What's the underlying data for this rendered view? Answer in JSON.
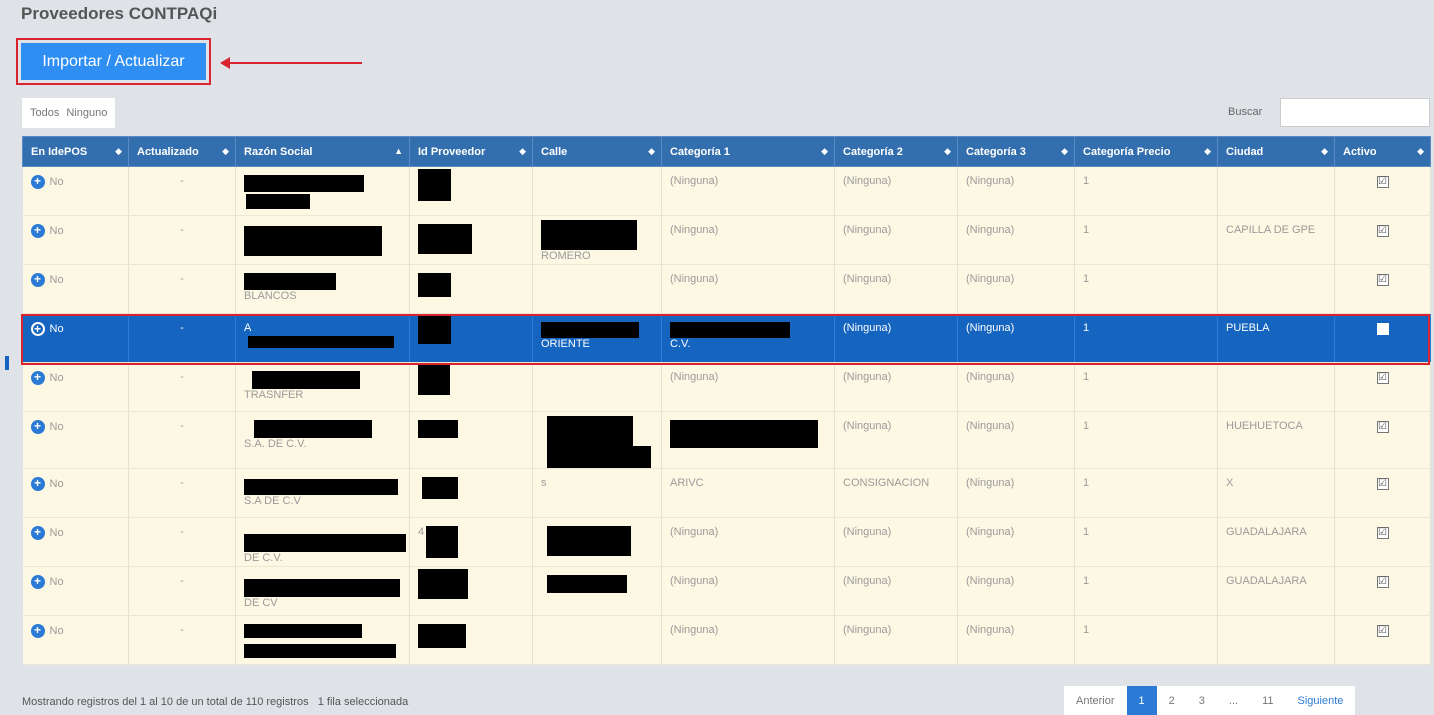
{
  "page": {
    "title": "Proveedores CONTPAQi",
    "import_button": "Importar / Actualizar",
    "select_all": "Todos",
    "select_none": "Ninguno",
    "search_label": "Buscar",
    "search_value": ""
  },
  "table": {
    "headers": [
      "En IdePOS",
      "Actualizado",
      "Razón Social",
      "Id Proveedor",
      "Calle",
      "Categoría 1",
      "Categoría 2",
      "Categoría 3",
      "Categoría Precio",
      "Ciudad",
      "Activo"
    ],
    "rows": [
      {
        "en": "No",
        "act": "-",
        "razon": "",
        "id": "",
        "calle": "",
        "c1": "(Ninguna)",
        "c2": "(Ninguna)",
        "c3": "(Ninguna)",
        "cp": "1",
        "ciudad": "",
        "activo": "☑"
      },
      {
        "en": "No",
        "act": "-",
        "razon": "",
        "id": "",
        "calle": "ROMERO",
        "c1": "(Ninguna)",
        "c2": "(Ninguna)",
        "c3": "(Ninguna)",
        "cp": "1",
        "ciudad": "CAPILLA DE GPE",
        "activo": "☑"
      },
      {
        "en": "No",
        "act": "-",
        "razon": "BLANCOS",
        "id": "",
        "calle": "",
        "c1": "(Ninguna)",
        "c2": "(Ninguna)",
        "c3": "(Ninguna)",
        "cp": "1",
        "ciudad": "",
        "activo": "☑"
      },
      {
        "en": "No",
        "act": "-",
        "razon": "A",
        "id": "",
        "calle": "ORIENTE",
        "c1": "C.V.",
        "c2": "(Ninguna)",
        "c3": "(Ninguna)",
        "cp": "1",
        "ciudad": "PUEBLA",
        "activo": "■"
      },
      {
        "en": "No",
        "act": "-",
        "razon": "TRASNFER",
        "id": "",
        "calle": "",
        "c1": "(Ninguna)",
        "c2": "(Ninguna)",
        "c3": "(Ninguna)",
        "cp": "1",
        "ciudad": "",
        "activo": "☑"
      },
      {
        "en": "No",
        "act": "-",
        "razon": "S.A. DE C.V.",
        "id": "",
        "calle": "",
        "c1": "",
        "c2": "(Ninguna)",
        "c3": "(Ninguna)",
        "cp": "1",
        "ciudad": "HUEHUETOCA",
        "activo": "☑"
      },
      {
        "en": "No",
        "act": "-",
        "razon": "S.A DE C.V",
        "id": "",
        "calle": "s",
        "c1": "ARIVC",
        "c2": "CONSIGNACION",
        "c3": "(Ninguna)",
        "cp": "1",
        "ciudad": "X",
        "activo": "☑"
      },
      {
        "en": "No",
        "act": "-",
        "razon": "DE C.V.",
        "id": "4",
        "calle": "",
        "c1": "(Ninguna)",
        "c2": "(Ninguna)",
        "c3": "(Ninguna)",
        "cp": "1",
        "ciudad": "GUADALAJARA",
        "activo": "☑"
      },
      {
        "en": "No",
        "act": "-",
        "razon": "DE CV",
        "id": "",
        "calle": "",
        "c1": "(Ninguna)",
        "c2": "(Ninguna)",
        "c3": "(Ninguna)",
        "cp": "1",
        "ciudad": "GUADALAJARA",
        "activo": "☑"
      },
      {
        "en": "No",
        "act": "-",
        "razon": "",
        "id": "",
        "calle": "",
        "c1": "(Ninguna)",
        "c2": "(Ninguna)",
        "c3": "(Ninguna)",
        "cp": "1",
        "ciudad": "",
        "activo": "☑"
      }
    ]
  },
  "footer": {
    "summary": "Mostrando registros del 1 al 10 de un total de 110 registros",
    "selected": "1 fila seleccionada",
    "pager": [
      "Anterior",
      "1",
      "2",
      "3",
      "...",
      "11",
      "Siguiente"
    ]
  },
  "colors": {
    "header": "#336fae",
    "selected": "#1565c0",
    "accent": "#2e8ef2",
    "highlight": "#d9232d"
  }
}
